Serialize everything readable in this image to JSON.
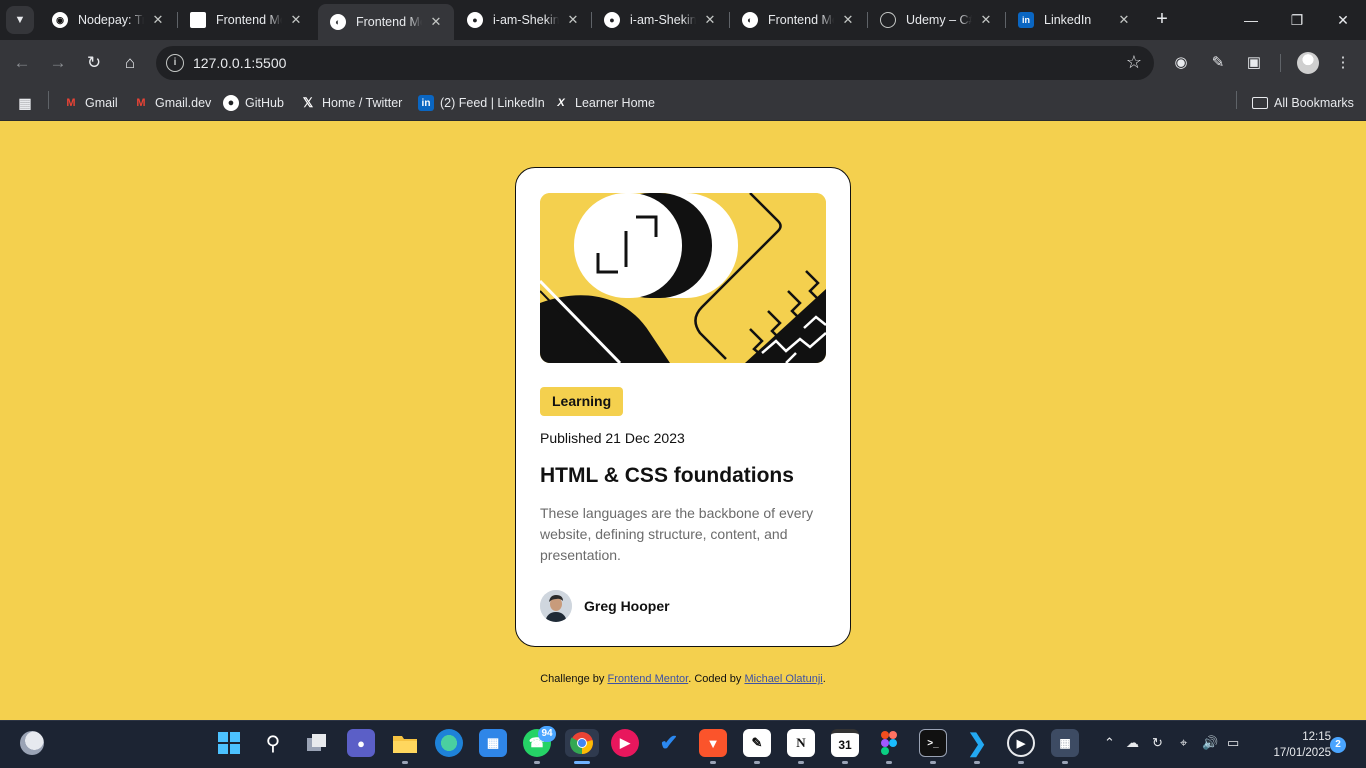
{
  "browser": {
    "tabs": [
      {
        "title": "Nodepay: Tra",
        "icon": "nodepay-icon",
        "active": false
      },
      {
        "title": "Frontend Me",
        "icon": "frontend-mentor-icon",
        "active": false
      },
      {
        "title": "Frontend Me",
        "icon": "frontend-mentor-icon",
        "active": true
      },
      {
        "title": "i-am-Shekina",
        "icon": "github-icon",
        "active": false
      },
      {
        "title": "i-am-Shekina",
        "icon": "github-icon",
        "active": false
      },
      {
        "title": "Frontend Me",
        "icon": "frontend-mentor-icon",
        "active": false
      },
      {
        "title": "Udemy – C#",
        "icon": "globe-icon",
        "active": false
      },
      {
        "title": "LinkedIn",
        "icon": "linkedin-icon",
        "active": false
      }
    ],
    "address": "127.0.0.1:5500",
    "bookmarks": [
      {
        "label": "Gmail",
        "icon": "gmail-icon"
      },
      {
        "label": "Gmail.dev",
        "icon": "gmail-icon"
      },
      {
        "label": "GitHub",
        "icon": "github-icon"
      },
      {
        "label": "Home / Twitter",
        "icon": "x-icon"
      },
      {
        "label": "(2) Feed | LinkedIn",
        "icon": "linkedin-icon"
      },
      {
        "label": "Learner Home",
        "icon": "edx-icon"
      }
    ],
    "all_bookmarks": "All Bookmarks"
  },
  "card": {
    "tag": "Learning",
    "published": "Published 21 Dec 2023",
    "title": "HTML & CSS foundations",
    "description": "These languages are the backbone of every website, defining structure, content, and presentation.",
    "author": "Greg Hooper"
  },
  "attribution": {
    "prefix": "Challenge by ",
    "link1": "Frontend Mentor",
    "middle": ". Coded by ",
    "link2": "Michael Olatunji",
    "suffix": "."
  },
  "taskbar": {
    "whatsapp_badge": "94",
    "calendar_day": "31",
    "time": "12:15",
    "date": "17/01/2025",
    "notifications": "2"
  },
  "colors": {
    "page_bg": "#f4d04e",
    "card_bg": "#ffffff",
    "text": "#111111",
    "muted": "#6b6b6b",
    "link": "#3e52a3"
  }
}
